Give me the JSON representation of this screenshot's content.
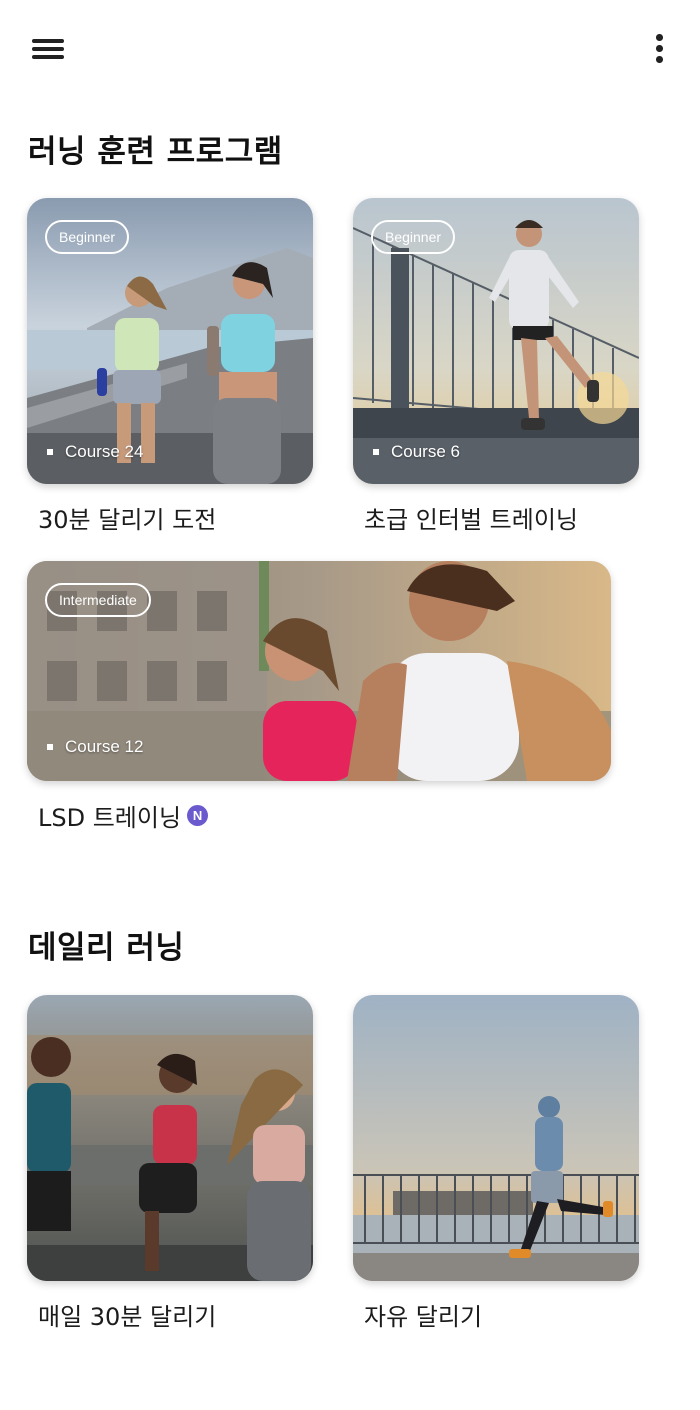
{
  "header": {
    "menu_icon": "hamburger-menu-icon",
    "more_icon": "more-vertical-icon"
  },
  "programs": {
    "title": "러닝 훈련 프로그램",
    "cards": [
      {
        "badge": "Beginner",
        "course": "Course 24",
        "label": "30분 달리기 도전"
      },
      {
        "badge": "Beginner",
        "course": "Course 6",
        "label": "초급 인터벌 트레이닝"
      },
      {
        "badge": "Intermediate",
        "course": "Course 12",
        "label": "LSD 트레이닝",
        "new_badge": "N"
      }
    ]
  },
  "daily": {
    "title": "데일리 러닝",
    "cards": [
      {
        "label": "매일 30분 달리기"
      },
      {
        "label": "자유 달리기"
      }
    ]
  },
  "colors": {
    "new_badge": "#6a5acd",
    "text": "#1c1c1c"
  }
}
